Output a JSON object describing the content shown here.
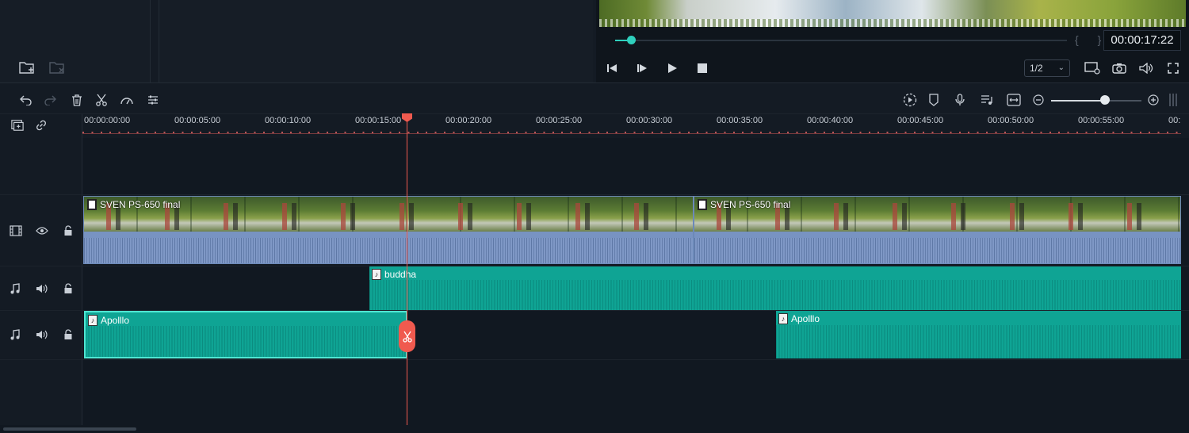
{
  "preview": {
    "timecode": "00:00:17:22",
    "braces": "{ }",
    "zoom_value": "1/2",
    "progress_fraction": 0.035
  },
  "media_panel": {
    "icons": [
      "add-folder-icon",
      "remove-folder-icon"
    ]
  },
  "player_controls": [
    "step-back-icon",
    "step-forward-icon",
    "play-icon",
    "stop-icon"
  ],
  "right_controls": [
    "render-preview-icon",
    "snapshot-icon",
    "volume-icon",
    "fullscreen-icon"
  ],
  "toolbar": {
    "left_tools": [
      "undo-icon",
      "redo-icon",
      "delete-icon",
      "cut-icon",
      "speed-icon",
      "adjust-icon"
    ],
    "right_tools": [
      "render-icon",
      "marker-icon",
      "voiceover-icon",
      "audio-mixer-icon",
      "fit-icon",
      "zoom-out-icon",
      "zoom-in-icon"
    ],
    "zoom_level_fraction": 0.6
  },
  "ruler": {
    "labels": [
      "00:00:00:00",
      "00:00:05:00",
      "00:00:10:00",
      "00:00:15:00",
      "00:00:20:00",
      "00:00:25:00",
      "00:00:30:00",
      "00:00:35:00",
      "00:00:40:00",
      "00:00:45:00",
      "00:00:50:00",
      "00:00:55:00",
      "00:"
    ]
  },
  "tracks": {
    "video": {
      "clips": [
        {
          "name": "SVEN PS-650 final"
        },
        {
          "name": "SVEN PS-650 final"
        }
      ]
    },
    "audio1": {
      "clips": [
        {
          "name": "buddha"
        }
      ]
    },
    "audio2": {
      "clips": [
        {
          "name": "Apolllo"
        },
        {
          "name": "Apolllo"
        }
      ]
    }
  },
  "playhead": {
    "time": "00:00:17:22"
  }
}
